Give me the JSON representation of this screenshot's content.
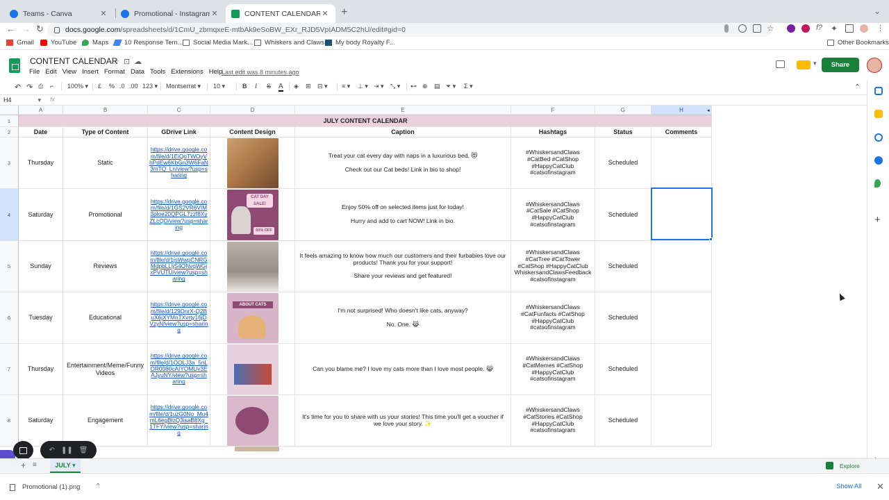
{
  "browser": {
    "tabs": [
      {
        "title": "Teams - Canva",
        "active": false
      },
      {
        "title": "Promotional - Instagram Post",
        "active": false
      },
      {
        "title": "CONTENT CALENDAR - Googl",
        "active": true
      }
    ],
    "url": {
      "host": "docs.google.com",
      "path": "/spreadsheets/d/1CmU_zbmqxeE-mtbAk9eSoBW_EXr_RJD5VpIADM5C2hU/edit#gid=0"
    },
    "bookmarks": [
      "Gmail",
      "YouTube",
      "Maps",
      "10 Response Tem...",
      "Social Media Mark...",
      "Whiskers and Claws",
      "My body Royalty F..."
    ],
    "other_bookmarks": "Other Bookmarks"
  },
  "doc": {
    "title": "CONTENT CALENDAR",
    "menu": [
      "File",
      "Edit",
      "View",
      "Insert",
      "Format",
      "Data",
      "Tools",
      "Extensions",
      "Help"
    ],
    "last_edit": "Last edit was 8 minutes ago",
    "share_label": "Share"
  },
  "toolbar": {
    "zoom": "100%",
    "currency": "£",
    "percent": "%",
    "dec_less": ".0",
    "dec_more": ".00",
    "number_format": "123",
    "font": "Montserrat",
    "font_size": "10",
    "bold": "B",
    "italic": "I",
    "strike": "S",
    "text_color": "A"
  },
  "formula_bar": {
    "cell_ref": "H4",
    "fx": "fx"
  },
  "sheet": {
    "columns": [
      "A",
      "B",
      "C",
      "D",
      "E",
      "F",
      "G",
      "H"
    ],
    "title": "JULY CONTENT CALENDAR",
    "headers": [
      "Date",
      "Type of Content",
      "GDrive Link",
      "Content Design",
      "Caption",
      "Hashtags",
      "Status",
      "Comments"
    ],
    "rows": [
      {
        "num": "3",
        "date": "Thursday",
        "type": "Static",
        "link": "https://drive.google.com/file/d/1EiQoTWOyVhPdEw6KbGn3W6FaN3mTQ_Ln/view?usp=sharing",
        "caption1": "Treat your cat every day with naps in a luxurious bed. 😻",
        "caption2": "Check out our Cat beds! Link in bio to shop!",
        "hashtags": "#WhiskersandClaws\n#CatBed #CatShop\n#HappyCatClub\n#catsofinstagram",
        "status": "Scheduled"
      },
      {
        "num": "4",
        "date": "Saturday",
        "type": "Promotional",
        "link": "https://drive.google.com/file/d/1GS2VR6VIM3ploe20QPGL7zzf8XyZLcQD/view?usp=sharing",
        "caption1": "Enjoy 50% off on selected items just for today!",
        "caption2": "Hurry and add to cart NOW! Link in bio.",
        "hashtags": "#WhiskersandClaws\n#CatSale #CatShop\n#HappyCatClub\n#catsofinstagram",
        "status": "Scheduled"
      },
      {
        "num": "5",
        "date": "Sunday",
        "type": "Reviews",
        "link": "https://drive.google.com/file/d/1jsWwpCNRGMdpbLLljS4ONvqWGjxPVUTU/view?usp=sharing",
        "caption1": "It feels amazing to know how much our customers and their furbabies love our products! Thank you for your support!",
        "caption2": "Share your reviews and get featured!",
        "hashtags": "#WhiskersandClaws\n#CatTree #CatTower\n#CatShop #HappyCatClub\nWhiskersandClawsFeedback\n#catsofinstagram",
        "status": "Scheduled"
      },
      {
        "num": "6",
        "date": "Tuesday",
        "type": "Educational",
        "link": "https://drive.google.com/file/d/129DnrX-Q2BuX6jXYMnTXvrty16jDVzyN/view?usp=sharing",
        "caption1": "I'm not surprised! Who doesn't like cats, anyway?",
        "caption2": "No. One. 😹",
        "hashtags": "#WhiskersandClaws\n#CatFunfacts #CatShop\n#HappyCatClub\n#catsofinstagram",
        "status": "Scheduled"
      },
      {
        "num": "7",
        "date": "Thursday",
        "type": "Entertainment/Meme/Funny Videos",
        "link": "https://drive.google.com/file/d/1OOLJ3a_5nLOR0080cAIYOMUv3EAJyuNY/view?usp=sharing",
        "caption1": "Can you blame me? I love my cats more than I love most people. 😹",
        "caption2": "",
        "hashtags": "#WhiskersandClaws\n#CatMemes #CatShop\n#HappyCatClub\n#catsofinstagram",
        "status": "Scheduled"
      },
      {
        "num": "8",
        "date": "Saturday",
        "type": "Engagement",
        "link": "https://drive.google.com/file/d/1uzG0No_Mu4mL6egBlzQ3isaB8Xg_1TFY/view?usp=sharing",
        "caption1": "It's time for you to share with us your stories! This time you'll get a voucher if we love your story. ✨",
        "caption2": "",
        "hashtags": "#WhiskersandClaws\n#CatStories #CatShop\n#HappyCatClub\n#catsofinstagram",
        "status": "Scheduled"
      }
    ],
    "design_images": [
      {
        "name": "cat-bed-photo",
        "bg": "#b07a4a"
      },
      {
        "name": "cat-day-sale-graphic",
        "bg": "#8e4a73",
        "text": "CAT DAY SALE!",
        "sub": "60% OFF"
      },
      {
        "name": "cat-tree-photo",
        "bg": "#9a8f86"
      },
      {
        "name": "about-cats-graphic",
        "bg": "#d8b4c8",
        "text": "ABOUT CATS"
      },
      {
        "name": "cat-meme-graphic",
        "bg": "#e6d0dc"
      },
      {
        "name": "share-story-graphic",
        "bg": "#d9b8cb"
      }
    ],
    "tab_name": "JULY"
  },
  "footer": {
    "explore": "Explore",
    "download_file": "Promotional (1).png",
    "show_all": "Show All"
  }
}
